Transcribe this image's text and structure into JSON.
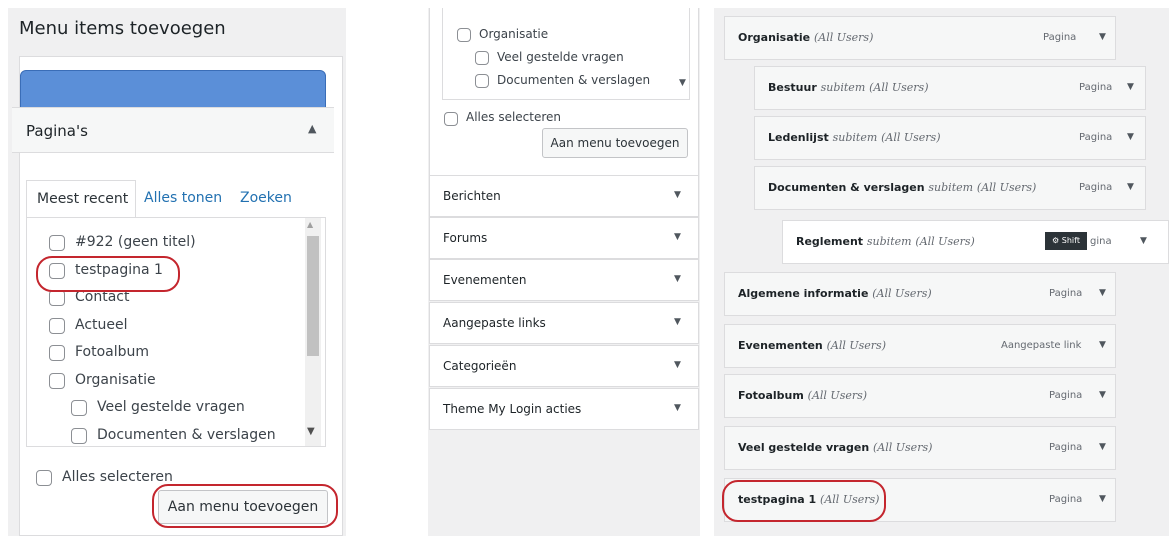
{
  "left_panel": {
    "title": "Menu items toevoegen",
    "section": "Pagina's",
    "tabs": [
      "Meest recent",
      "Alles tonen",
      "Zoeken"
    ],
    "pages": [
      "#922 (geen titel)",
      "testpagina 1",
      "Contact",
      "Actueel",
      "Fotoalbum",
      "Organisatie",
      "Veel gestelde vragen",
      "Documenten & verslagen"
    ],
    "select_all": "Alles selecteren",
    "add_button": "Aan menu toevoegen"
  },
  "middle_panel": {
    "pages": [
      "Organisatie",
      "Veel gestelde vragen",
      "Documenten & verslagen"
    ],
    "select_all": "Alles selecteren",
    "add_button": "Aan menu toevoegen",
    "sections": [
      "Berichten",
      "Forums",
      "Evenementen",
      "Aangepaste links",
      "Categorieën",
      "Theme My Login acties"
    ]
  },
  "menu_structure": {
    "items": [
      {
        "title": "Organisatie",
        "sub": "",
        "users": "(All Users)",
        "type": "Pagina"
      },
      {
        "title": "Bestuur",
        "sub": "subitem",
        "users": "(All Users)",
        "type": "Pagina"
      },
      {
        "title": "Ledenlijst",
        "sub": "subitem",
        "users": "(All Users)",
        "type": "Pagina"
      },
      {
        "title": "Documenten & verslagen",
        "sub": "subitem",
        "users": "(All Users)",
        "type": "Pagina"
      },
      {
        "title": "Reglement",
        "sub": "subitem",
        "users": "(All Users)",
        "type": "gina"
      },
      {
        "title": "Algemene informatie",
        "sub": "",
        "users": "(All Users)",
        "type": "Pagina"
      },
      {
        "title": "Evenementen",
        "sub": "",
        "users": "(All Users)",
        "type": "Aangepaste link"
      },
      {
        "title": "Fotoalbum",
        "sub": "",
        "users": "(All Users)",
        "type": "Pagina"
      },
      {
        "title": "Veel gestelde vragen",
        "sub": "",
        "users": "(All Users)",
        "type": "Pagina"
      },
      {
        "title": "testpagina 1",
        "sub": "",
        "users": "(All Users)",
        "type": "Pagina"
      }
    ],
    "shift_badge": "Shift"
  },
  "colors": {
    "accent": "#2271b1",
    "highlight": "#c4262e",
    "redacted": "#5b8fd8"
  }
}
